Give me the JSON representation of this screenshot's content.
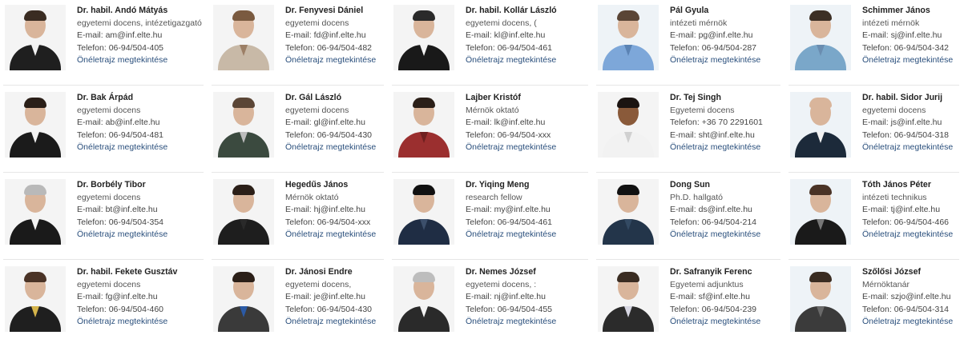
{
  "cards": [
    {
      "name": "Dr. habil. Andó Mátyás",
      "title": "egyetemi docens, intézetigazgató",
      "email": "E-mail: am@inf.elte.hu",
      "phone": "Telefon: 06-94/504-405",
      "cv": "Önéletrajz megtekintése"
    },
    {
      "name": "Dr. Fenyvesi Dániel",
      "title": "egyetemi docens",
      "email": "E-mail: fd@inf.elte.hu",
      "phone": "Telefon: 06-94/504-482",
      "cv": "Önéletrajz megtekintése"
    },
    {
      "name": "Dr. habil. Kollár László",
      "title": "egyetemi docens, (",
      "email": "E-mail: kl@inf.elte.hu",
      "phone": "Telefon: 06-94/504-461",
      "cv": "Önéletrajz megtekintése"
    },
    {
      "name": "Pál Gyula",
      "title": "intézeti mérnök",
      "email": "E-mail: pg@inf.elte.hu",
      "phone": "Telefon: 06-94/504-287",
      "cv": "Önéletrajz megtekintése"
    },
    {
      "name": "Schimmer János",
      "title": "intézeti mérnök",
      "email": "E-mail: sj@inf.elte.hu",
      "phone": "Telefon: 06-94/504-342",
      "cv": "Önéletrajz megtekintése"
    },
    {
      "name": "Dr. Bak Árpád",
      "title": "egyetemi docens",
      "email": "E-mail: ab@inf.elte.hu",
      "phone": "Telefon: 06-94/504-481",
      "cv": "Önéletrajz megtekintése"
    },
    {
      "name": "Dr. Gál László",
      "title": "egyetemi docens",
      "email": "E-mail: gl@inf.elte.hu",
      "phone": "Telefon: 06-94/504-430",
      "cv": "Önéletrajz megtekintése"
    },
    {
      "name": "Lajber Kristóf",
      "title": "Mérnök oktató",
      "email": "E-mail: lk@inf.elte.hu",
      "phone": "Telefon: 06-94/504-xxx",
      "cv": "Önéletrajz megtekintése"
    },
    {
      "name": "Dr. Tej Singh",
      "title": "Egyetemi docens",
      "email": "Telefon: +36 70 2291601",
      "phone": "E-mail: sht@inf.elte.hu",
      "cv": "Önéletrajz megtekintése"
    },
    {
      "name": "Dr. habil. Sidor Jurij",
      "title": "egyetemi docens",
      "email": "E-mail: js@inf.elte.hu",
      "phone": "Telefon: 06-94/504-318",
      "cv": "Önéletrajz megtekintése"
    },
    {
      "name": "Dr. Borbély Tibor",
      "title": "egyetemi docens",
      "email": "E-mail: bt@inf.elte.hu",
      "phone": "Telefon: 06-94/504-354",
      "cv": "Önéletrajz megtekintése"
    },
    {
      "name": "Hegedűs János",
      "title": "Mérnök oktató",
      "email": "E-mail: hj@inf.elte.hu",
      "phone": "Telefon: 06-94/504-xxx",
      "cv": "Önéletrajz megtekintése"
    },
    {
      "name": "Dr. Yiqing Meng",
      "title": "research fellow",
      "email": "E-mail: my@inf.elte.hu",
      "phone": "Telefon: 06-94/504-461",
      "cv": "Önéletrajz megtekintése"
    },
    {
      "name": "Dong Sun",
      "title": "Ph.D. hallgató",
      "email": "E-mail: ds@inf.elte.hu",
      "phone": "Telefon: 06-94/504-214",
      "cv": "Önéletrajz megtekintése"
    },
    {
      "name": "Tóth János Péter",
      "title": "intézeti technikus",
      "email": "E-mail: tj@inf.elte.hu",
      "phone": "Telefon: 06-94/504-466",
      "cv": "Önéletrajz megtekintése"
    },
    {
      "name": "Dr. habil. Fekete Gusztáv",
      "title": "egyetemi docens",
      "email": "E-mail: fg@inf.elte.hu",
      "phone": "Telefon: 06-94/504-460",
      "cv": "Önéletrajz megtekintése"
    },
    {
      "name": "Dr. Jánosi Endre",
      "title": "egyetemi docens,",
      "email": "E-mail: je@inf.elte.hu",
      "phone": "Telefon: 06-94/504-430",
      "cv": "Önéletrajz megtekintése"
    },
    {
      "name": "Dr. Nemes József",
      "title": "egyetemi docens, :",
      "email": "E-mail: nj@inf.elte.hu",
      "phone": "Telefon: 06-94/504-455",
      "cv": "Önéletrajz megtekintése"
    },
    {
      "name": "Dr. Safranyik Ferenc",
      "title": "Egyetemi adjunktus",
      "email": "E-mail: sf@inf.elte.hu",
      "phone": "Telefon: 06-94/504-239",
      "cv": "Önéletrajz megtekintése"
    },
    {
      "name": "Szőlősi József",
      "title": "Mérnöktanár",
      "email": "E-mail: szjo@inf.elte.hu",
      "phone": "Telefon: 06-94/504-314",
      "cv": "Önéletrajz megtekintése"
    }
  ],
  "colors": {
    "link": "#2a4f7c",
    "name": "#222222",
    "text": "#444444",
    "divider": "#e6e6e6"
  }
}
